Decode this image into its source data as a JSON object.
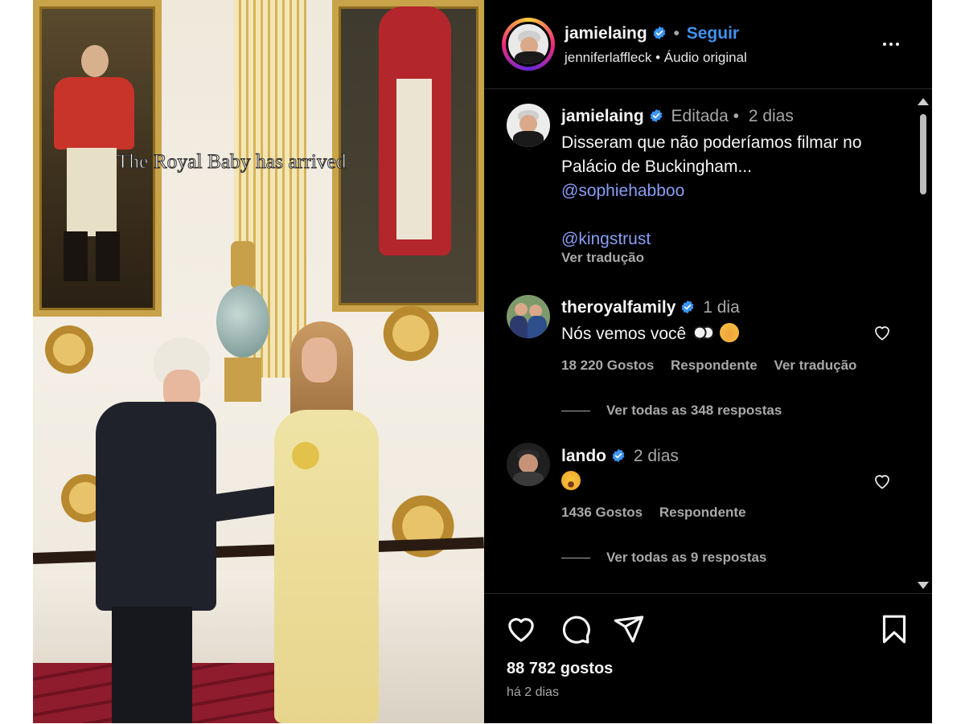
{
  "media": {
    "caption": "The Royal Baby has arrived"
  },
  "header": {
    "username": "jamielaing",
    "dot": "•",
    "follow_label": "Seguir",
    "subtitle_user": "jenniferlaffleck",
    "subtitle_sep": "•",
    "audio_label": "Áudio original",
    "more_icon": "more-horizontal-icon"
  },
  "caption_comment": {
    "username": "jamielaing",
    "edited": "Editada",
    "sep": "•",
    "time": "2 dias",
    "text_line1": "Disseram que não poderíamos filmar no",
    "text_line2": "Palácio de Buckingham...",
    "mention1": "@sophiehabboo",
    "mention2": "@kingstrust",
    "translate": "Ver tradução"
  },
  "comments": [
    {
      "username": "theroyalfamily",
      "time": "1 dia",
      "text": "Nós vemos você",
      "emojis": [
        "eyes-emoji",
        "smiling-face-emoji"
      ],
      "likes": "18 220 Gostos",
      "reply": "Respondente",
      "translate": "Ver tradução",
      "view_replies": "Ver todas as 348 respostas"
    },
    {
      "username": "lando",
      "time": "2 dias",
      "text": "",
      "emojis": [
        "tears-of-joy-emoji"
      ],
      "likes": "1436 Gostos",
      "reply": "Respondente",
      "view_replies": "Ver todas as 9 respostas"
    }
  ],
  "footer": {
    "likes": "88 782 gostos",
    "date": "há 2 dias",
    "icons": [
      "heart-icon",
      "comment-icon",
      "share-icon",
      "bookmark-icon"
    ]
  },
  "colors": {
    "accent_blue": "#4192ef",
    "mention": "#8a9ef5",
    "muted": "#a8a8a8",
    "background": "#000000"
  }
}
